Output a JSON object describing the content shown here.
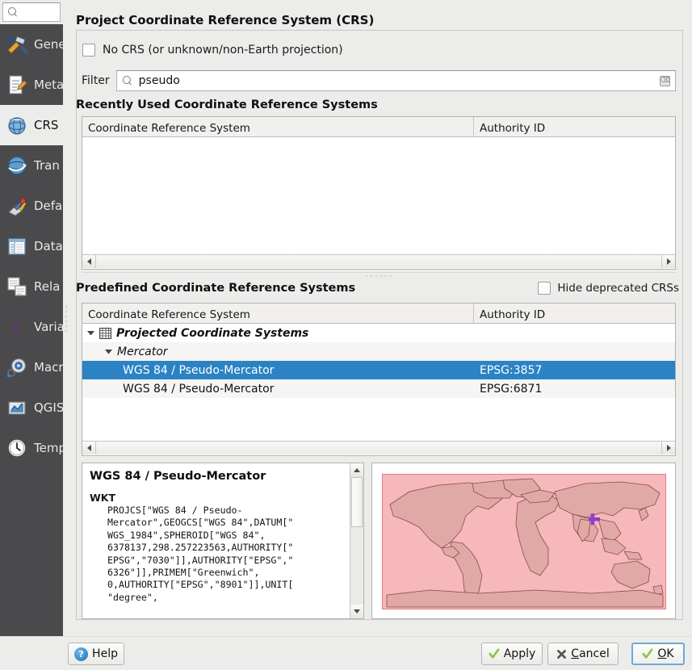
{
  "sidebar": {
    "search_placeholder": "",
    "search_icon": "search-icon",
    "items": [
      {
        "label": "Gene",
        "icon": "hammer-wrench-icon",
        "selected": false
      },
      {
        "label": "Meta",
        "icon": "document-pencil-icon",
        "selected": false
      },
      {
        "label": "CRS",
        "icon": "globe-icon",
        "selected": true
      },
      {
        "label": "Tran",
        "icon": "globe-arrows-icon",
        "selected": false
      },
      {
        "label": "Defa",
        "icon": "paintbrush-icon",
        "selected": false
      },
      {
        "label": "Data",
        "icon": "table-icon",
        "selected": false
      },
      {
        "label": "Rela",
        "icon": "relations-icon",
        "selected": false
      },
      {
        "label": "Varia",
        "icon": "epsilon-icon",
        "selected": false
      },
      {
        "label": "Macr",
        "icon": "gear-play-icon",
        "selected": false
      },
      {
        "label": "QGIS",
        "icon": "qgis-server-icon",
        "selected": false
      },
      {
        "label": "Temp",
        "icon": "clock-icon",
        "selected": false
      }
    ]
  },
  "page": {
    "title": "Project Coordinate Reference System (CRS)"
  },
  "no_crs": {
    "label": "No CRS (or unknown/non-Earth projection)",
    "checked": false
  },
  "filter": {
    "label": "Filter",
    "value": "pseudo",
    "placeholder": "",
    "search_icon": "search-icon",
    "clear_icon": "clear-icon",
    "clear_glyph": "⌫"
  },
  "recent": {
    "title": "Recently Used Coordinate Reference Systems",
    "columns": [
      "Coordinate Reference System",
      "Authority ID"
    ],
    "rows": []
  },
  "predefined": {
    "title": "Predefined Coordinate Reference Systems",
    "hide_deprecated": {
      "label": "Hide deprecated CRSs",
      "checked": false
    },
    "columns": [
      "Coordinate Reference System",
      "Authority ID"
    ],
    "rows": [
      {
        "kind": "group",
        "depth": 0,
        "expanded": true,
        "icon": "grid-icon",
        "name": "Projected Coordinate Systems",
        "authority": "",
        "selected": false
      },
      {
        "kind": "group",
        "depth": 1,
        "expanded": true,
        "icon": "",
        "name": "Mercator",
        "authority": "",
        "selected": false
      },
      {
        "kind": "leaf",
        "depth": 2,
        "expanded": false,
        "icon": "",
        "name": "WGS 84 / Pseudo-Mercator",
        "authority": "EPSG:3857",
        "selected": true
      },
      {
        "kind": "leaf",
        "depth": 2,
        "expanded": false,
        "icon": "",
        "name": "WGS 84 / Pseudo-Mercator",
        "authority": "EPSG:6871",
        "selected": false
      }
    ]
  },
  "details": {
    "title": "WGS 84 / Pseudo-Mercator",
    "wkt_label": "WKT",
    "wkt_text": "PROJCS[\"WGS 84 / Pseudo-\nMercator\",GEOGCS[\"WGS 84\",DATUM[\"\nWGS_1984\",SPHEROID[\"WGS 84\",\n6378137,298.257223563,AUTHORITY[\"\nEPSG\",\"7030\"]],AUTHORITY[\"EPSG\",\"\n6326\"]],PRIMEM[\"Greenwich\",\n0,AUTHORITY[\"EPSG\",\"8901\"]],UNIT[\n\"degree\","
  },
  "map_preview": {
    "name": "crs-extent-preview",
    "extent_fill": "#f6b8bb",
    "extent_stroke": "#e8666c",
    "land_fill": "#e0a9a5",
    "land_stroke": "#8a4a4a",
    "marker_color": "#8f3fcf",
    "marker_icon": "cross-marker-icon"
  },
  "buttons": {
    "help": {
      "label": "Help",
      "icon": "help-icon",
      "mnemonic": ""
    },
    "apply": {
      "label": "Apply",
      "icon": "check-icon",
      "mnemonic": ""
    },
    "cancel": {
      "label": "Cancel",
      "icon": "x-icon",
      "mnemonic": "C",
      "pre": "",
      "post": "ancel"
    },
    "ok": {
      "label": "OK",
      "icon": "check-icon",
      "mnemonic": "O",
      "pre": "",
      "post": "K"
    }
  },
  "colors": {
    "selection_blue": "#2b83c4",
    "sidebar_bg": "#4a4a4c",
    "window_bg": "#ececeb",
    "default_button_border": "#6fa8d8"
  }
}
